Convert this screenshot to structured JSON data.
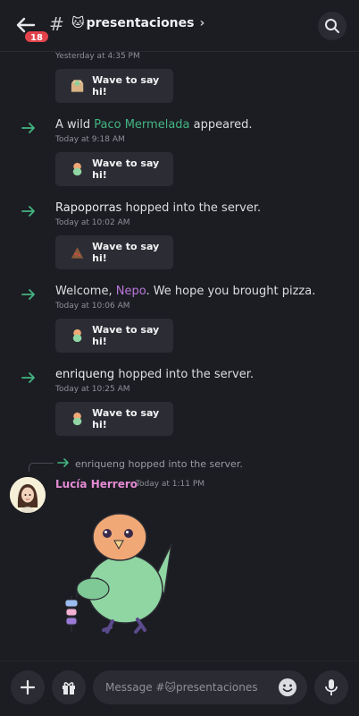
{
  "header": {
    "badge": "18",
    "hash": "#",
    "channel_emoji": "🐱",
    "channel_name": "presentaciones",
    "chevron": "›",
    "icons": [
      "back-arrow-icon",
      "search-icon"
    ]
  },
  "messages": {
    "first_timestamp": "Yesterday at 4:35 PM",
    "wave_label": "Wave to say hi!",
    "events": [
      {
        "prefix": "A wild ",
        "name": "Paco Mermelada",
        "suffix": " appeared.",
        "timestamp": "Today at 9:18 AM"
      },
      {
        "prefix": "",
        "name": "Rapoporras",
        "suffix": " hopped into the server.",
        "timestamp": "Today at 10:02 AM"
      },
      {
        "prefix": "Welcome, ",
        "name": "Nepo",
        "suffix": ". We hope you brought pizza.",
        "timestamp": "Today at 10:06 AM"
      },
      {
        "prefix": "",
        "name": "enriqueng",
        "suffix": " hopped into the server.",
        "timestamp": "Today at 10:25 AM"
      }
    ],
    "reply": {
      "text": "enriqueng hopped into the server."
    },
    "post": {
      "author": "Lucía Herrero",
      "timestamp": "Today at 1:11 PM"
    }
  },
  "composer": {
    "placeholder": "Message #🐱presentaciones",
    "icons": [
      "plus-icon",
      "gift-icon",
      "emoji-icon",
      "microphone-icon"
    ]
  },
  "colors": {
    "background": "#1c1d23",
    "badge": "#e2434a",
    "join_arrow": "#43b582",
    "paco_name": "#43b582",
    "nepo_name": "#b878d9",
    "lucia_name": "#e38bd3"
  }
}
